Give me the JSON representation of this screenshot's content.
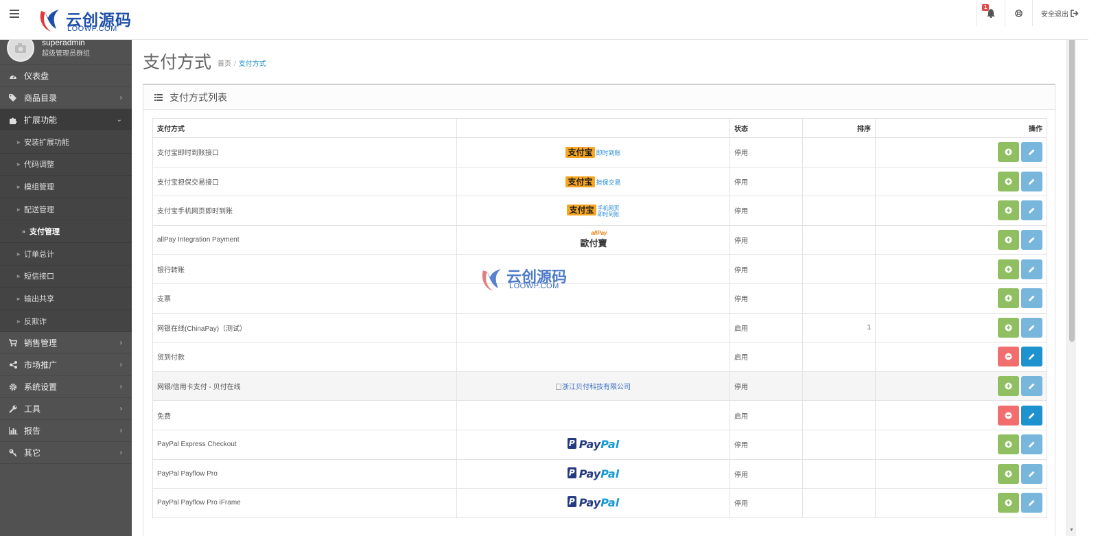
{
  "header": {
    "logo_text": "云创源码",
    "logo_sub": "LOOWP.COM",
    "notification_count": "1",
    "logout_label": "安全退出"
  },
  "profile": {
    "name": "superadmin",
    "group": "超级管理员群组"
  },
  "sidebar": {
    "items": [
      {
        "label": "仪表盘",
        "icon": "dashboard-icon"
      },
      {
        "label": "商品目录",
        "icon": "tags-icon"
      },
      {
        "label": "扩展功能",
        "icon": "puzzle-icon",
        "expanded": true
      },
      {
        "label": "销售管理",
        "icon": "cart-icon"
      },
      {
        "label": "市场推广",
        "icon": "share-icon"
      },
      {
        "label": "系统设置",
        "icon": "gear-icon"
      },
      {
        "label": "工具",
        "icon": "wrench-icon"
      },
      {
        "label": "报告",
        "icon": "bar-chart-icon"
      },
      {
        "label": "其它",
        "icon": "key-icon"
      }
    ],
    "sub_items": [
      {
        "label": "安装扩展功能"
      },
      {
        "label": "代码调整"
      },
      {
        "label": "模组管理"
      },
      {
        "label": "配送管理"
      },
      {
        "label": "支付管理",
        "current": true
      },
      {
        "label": "订单总计"
      },
      {
        "label": "短信接口"
      },
      {
        "label": "输出共享"
      },
      {
        "label": "反欺诈"
      }
    ]
  },
  "page": {
    "title": "支付方式",
    "breadcrumb": [
      "首页",
      "支付方式"
    ]
  },
  "panel": {
    "title": "支付方式列表"
  },
  "table": {
    "headers": {
      "name": "支付方式",
      "logo": "",
      "status": "状态",
      "sort": "排序",
      "action": "操作"
    },
    "rows": [
      {
        "name": "支付宝即时到账接口",
        "logo": "alipay",
        "logo_main": "支付宝",
        "logo_sub": "即时到账",
        "status": "停用",
        "sort": "",
        "installed": false
      },
      {
        "name": "支付宝担保交易接口",
        "logo": "alipay",
        "logo_main": "支付宝",
        "logo_sub": "担保交易",
        "status": "停用",
        "sort": "",
        "installed": false
      },
      {
        "name": "支付宝手机网页即时到账",
        "logo": "alipay2",
        "logo_main": "支付宝",
        "logo_sub": "手机网页",
        "logo_sub2": "即时到账",
        "status": "停用",
        "sort": "",
        "installed": false
      },
      {
        "name": "allPay Integration Payment",
        "logo": "allpay",
        "logo_top": "allPay",
        "logo_main": "歐付寶",
        "status": "停用",
        "sort": "",
        "installed": false
      },
      {
        "name": "银行转账",
        "logo": "",
        "status": "停用",
        "sort": "",
        "installed": false
      },
      {
        "name": "支票",
        "logo": "",
        "status": "停用",
        "sort": "",
        "installed": false
      },
      {
        "name": "网银在线(ChinaPay)（测试）",
        "logo": "",
        "status": "启用",
        "sort": "1",
        "installed": false
      },
      {
        "name": "货到付款",
        "logo": "",
        "status": "启用",
        "sort": "",
        "installed": true
      },
      {
        "name": "网银/信用卡支付 - 贝付在线",
        "logo": "broken",
        "logo_alt": "浙江贝付科技有限公司",
        "status": "停用",
        "sort": "",
        "installed": false,
        "hover": true
      },
      {
        "name": "免费",
        "logo": "",
        "status": "启用",
        "sort": "",
        "installed": true
      },
      {
        "name": "PayPal Express Checkout",
        "logo": "paypal",
        "logo_p1": "Pay",
        "logo_p2": "Pal",
        "status": "停用",
        "sort": "",
        "installed": false
      },
      {
        "name": "PayPal Payflow Pro",
        "logo": "paypal",
        "logo_p1": "Pay",
        "logo_p2": "Pal",
        "status": "停用",
        "sort": "",
        "installed": false
      },
      {
        "name": "PayPal Payflow Pro iFrame",
        "logo": "paypal",
        "logo_p1": "Pay",
        "logo_p2": "Pal",
        "status": "停用",
        "sort": "",
        "installed": false
      }
    ]
  },
  "watermark": {
    "text": "云创源码",
    "sub": "LOOWP.COM"
  },
  "colors": {
    "sidebar_bg": "#515151",
    "install_green": "#8fbf61",
    "uninstall_red": "#f26d6d",
    "edit_blue": "#1e91cf",
    "edit_light_blue": "#78b6dc",
    "link_blue": "#1e91cf"
  }
}
